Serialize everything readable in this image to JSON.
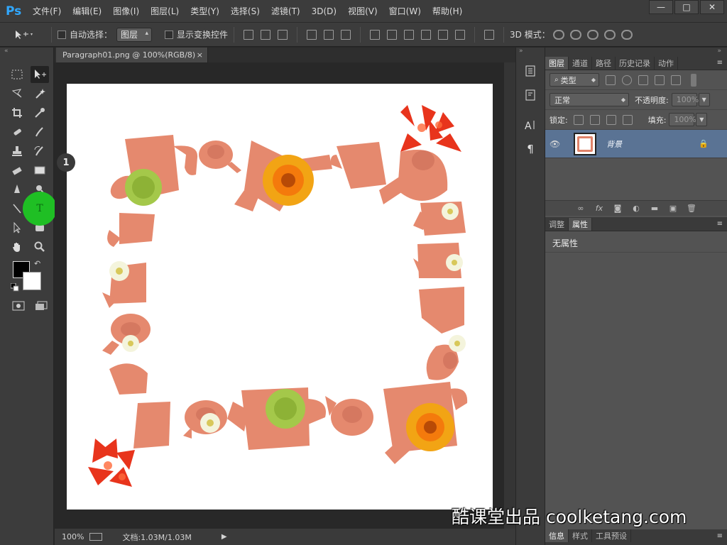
{
  "app": {
    "logo": "Ps",
    "menu": [
      "文件(F)",
      "编辑(E)",
      "图像(I)",
      "图层(L)",
      "类型(Y)",
      "选择(S)",
      "滤镜(T)",
      "3D(D)",
      "视图(V)",
      "窗口(W)",
      "帮助(H)"
    ],
    "window_controls": [
      "—",
      "□",
      "✕"
    ]
  },
  "options": {
    "auto_select_label": "自动选择：",
    "auto_select_value": "图层",
    "show_transform_label": "显示变换控件",
    "mode_3d_label": "3D 模式："
  },
  "document": {
    "tab_title": "Paragraph01.png @ 100%(RGB/8)",
    "tab_close": "×",
    "zoom": "100%",
    "doc_info": "文档:1.03M/1.03M"
  },
  "layers_panel": {
    "tabs": [
      "图层",
      "通道",
      "路径",
      "历史记录",
      "动作"
    ],
    "filter_label": "类型",
    "blend_mode": "正常",
    "opacity_label": "不透明度:",
    "opacity_value": "100%",
    "lock_label": "锁定:",
    "fill_label": "填充:",
    "fill_value": "100%",
    "layer_name": "背景"
  },
  "properties_panel": {
    "tabs": [
      "调整",
      "属性"
    ],
    "empty_text": "无属性"
  },
  "bottom_tabs": [
    "信息",
    "样式",
    "工具预设"
  ],
  "highlight": {
    "tool_glyph": "T",
    "step_number": "1"
  },
  "watermark": "酷课堂出品 coolketang.com",
  "colors": {
    "accent": "#31a8ff",
    "selected_layer": "#5a7394",
    "highlight": "#1fbf24",
    "foreground": "#000000",
    "background": "#ffffff"
  }
}
